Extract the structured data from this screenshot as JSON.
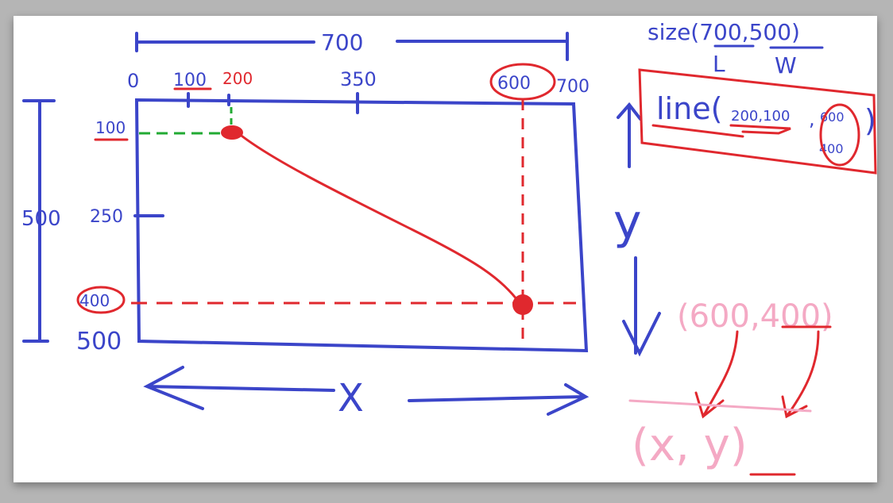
{
  "diagram": {
    "width_dim": "700",
    "top_axis": {
      "labels": [
        "0",
        "100",
        "200",
        "350",
        "600",
        "700"
      ]
    },
    "left_axis": {
      "labels": [
        "100",
        "250",
        "400",
        "500"
      ]
    },
    "height_dim": "500",
    "x_label": "X",
    "y_label": "y",
    "size_call": {
      "text_prefix": "size(",
      "length": "700",
      "sep": ",",
      "width": "500",
      "text_suffix": ")",
      "length_label": "L",
      "width_label": "W"
    },
    "line_call": {
      "text": "line(",
      "args": "200,100",
      "sep": ",",
      "end_x": "600",
      "end_y": "400",
      "close": ")"
    },
    "point_note": {
      "text": "(600,400)",
      "target": "(x, y)"
    },
    "colors": {
      "blue": "#3b45c9",
      "red": "#e0282e",
      "green": "#22aa33",
      "pink": "#f4a9c4"
    }
  }
}
